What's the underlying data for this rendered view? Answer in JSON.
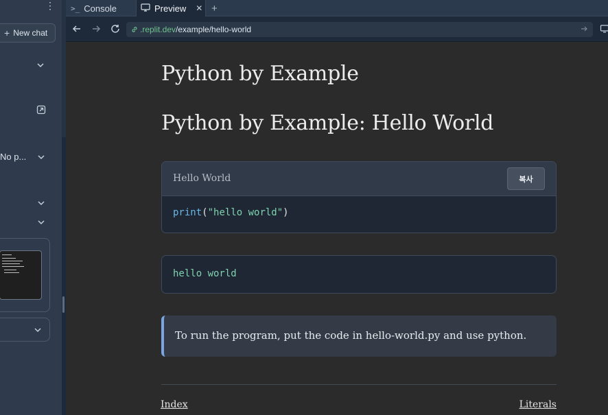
{
  "sidebar": {
    "new_chat_label": "New chat",
    "truncated_item": "No p..."
  },
  "tabs": {
    "console_label": "Console",
    "preview_label": "Preview",
    "close_symbol": "✕",
    "add_symbol": "+"
  },
  "address_bar": {
    "url_host": ".replit.dev",
    "url_path": "/example/hello-world"
  },
  "page": {
    "title": "Python by Example",
    "subtitle": "Python by Example: Hello World",
    "code_block": {
      "label": "Hello World",
      "copy_label": "복사",
      "code_fn": "print",
      "code_open": "(",
      "code_string": "\"hello world\"",
      "code_close": ")"
    },
    "output": "hello world",
    "note": "To run the program, put the code in hello-world.py and use python.",
    "nav": {
      "prev": "Index",
      "next": "Literals"
    }
  },
  "colors": {
    "accent_green": "#6fc28d",
    "code_keyword": "#69b7e6",
    "code_string": "#7fd3b0",
    "note_border": "#7aa6e0"
  },
  "icons": [
    "kebab-menu-icon",
    "plus-icon",
    "chevron-down-icon",
    "open-external-icon",
    "terminal-icon",
    "monitor-icon",
    "close-icon",
    "back-arrow-icon",
    "forward-arrow-icon",
    "reload-icon",
    "link-icon",
    "go-arrow-icon",
    "devices-icon"
  ]
}
